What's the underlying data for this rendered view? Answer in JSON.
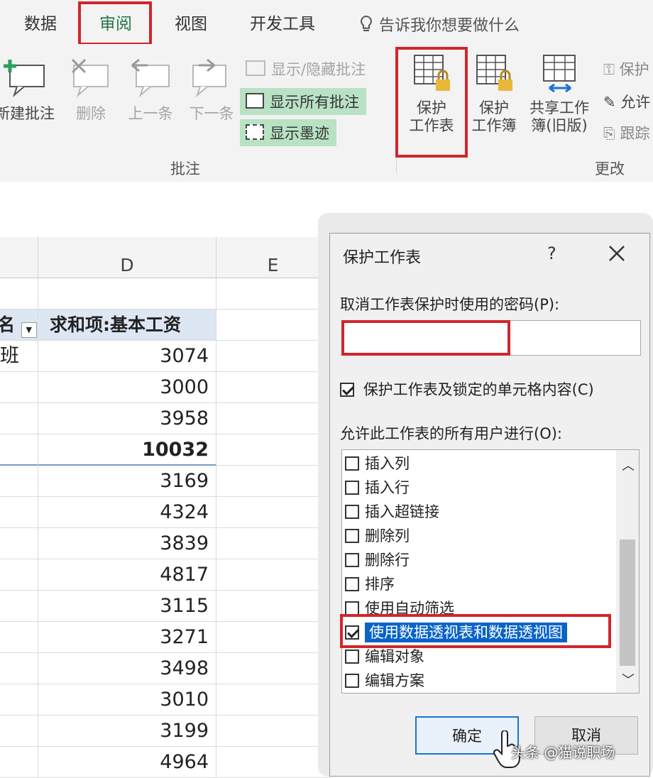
{
  "tabs": [
    {
      "label": "数据"
    },
    {
      "label": "审阅"
    },
    {
      "label": "视图"
    },
    {
      "label": "开发工具"
    }
  ],
  "tell_me": "告诉我你想要做什么",
  "ribbon": {
    "comments_group": {
      "new_comment": "新建批注",
      "delete": "删除",
      "previous": "上一条",
      "next": "下一条",
      "show_hide_comment": "显示/隐藏批注",
      "show_all_comments": "显示所有批注",
      "show_ink": "显示墨迹",
      "label": "批注"
    },
    "changes_group": {
      "protect_sheet_line1": "保护",
      "protect_sheet_line2": "工作表",
      "protect_workbook_line1": "保护",
      "protect_workbook_line2": "工作簿",
      "share_workbook_line1": "共享工作",
      "share_workbook_line2": "簿(旧版)",
      "allow_edit": "允许",
      "protect_share": "保护",
      "track": "跟踪",
      "label": "更改"
    }
  },
  "sheet": {
    "columns": [
      "D",
      "E"
    ],
    "left_header_fragment": "名",
    "pivot_header": "求和项:基本工资",
    "first_row_fragment": "班",
    "values": [
      "3074",
      "3000",
      "3958",
      "10032",
      "3169",
      "4324",
      "3839",
      "4817",
      "3115",
      "3271",
      "3498",
      "3010",
      "3199",
      "4964"
    ],
    "subtotal_index": 3
  },
  "dialog": {
    "title": "保护工作表",
    "help": "?",
    "password_label": "取消工作表保护时使用的密码(P):",
    "password_value": "",
    "protect_locked_label": "保护工作表及锁定的单元格内容(C)",
    "protect_locked_checked": true,
    "allow_label": "允许此工作表的所有用户进行(O):",
    "options": [
      {
        "label": "插入列",
        "checked": false
      },
      {
        "label": "插入行",
        "checked": false
      },
      {
        "label": "插入超链接",
        "checked": false
      },
      {
        "label": "删除列",
        "checked": false
      },
      {
        "label": "删除行",
        "checked": false
      },
      {
        "label": "排序",
        "checked": false
      },
      {
        "label": "使用自动筛选",
        "checked": false
      },
      {
        "label": "使用数据透视表和数据透视图",
        "checked": true
      },
      {
        "label": "编辑对象",
        "checked": false
      },
      {
        "label": "编辑方案",
        "checked": false
      }
    ],
    "ok": "确定",
    "cancel": "取消"
  },
  "watermark": "头条 @猫说职场",
  "colors": {
    "highlight_red": "#d1262b",
    "excel_green": "#217346",
    "selection_blue": "#0a64c8",
    "green_fill": "#b9e2c5"
  }
}
